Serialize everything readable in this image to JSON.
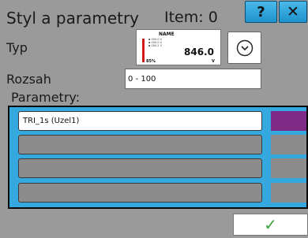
{
  "header": {
    "title": "Styl a parametry",
    "item_label": "Item: 0",
    "help_label": "?",
    "close_label": "✕"
  },
  "form": {
    "type_label": "Typ",
    "range_label": "Rozsah",
    "range_value": "0 - 100",
    "params_label": "Parametry:"
  },
  "preview": {
    "name": "NAME",
    "mini_lines": [
      "▪ 000.0 V",
      "▪ 000.0 V",
      "▪ 000.2 V"
    ],
    "value": "846.0",
    "percent": "85%",
    "unit": "V",
    "accent_color": "#d11a1a"
  },
  "dropdown": {
    "icon": "chevron-down-circle-icon"
  },
  "parameters": {
    "rows": [
      {
        "value": "TRI_1s (Uzel1)",
        "color": "#7f2a86"
      },
      {
        "value": "",
        "color": ""
      },
      {
        "value": "",
        "color": ""
      },
      {
        "value": "",
        "color": ""
      }
    ]
  },
  "confirm": {
    "icon": "checkmark-icon",
    "label": "✓"
  },
  "colors": {
    "background": "#9a9a9a",
    "button_blue": "#2ea3da",
    "panel_blue": "#35a9df",
    "confirm_green": "#3aa53a"
  }
}
